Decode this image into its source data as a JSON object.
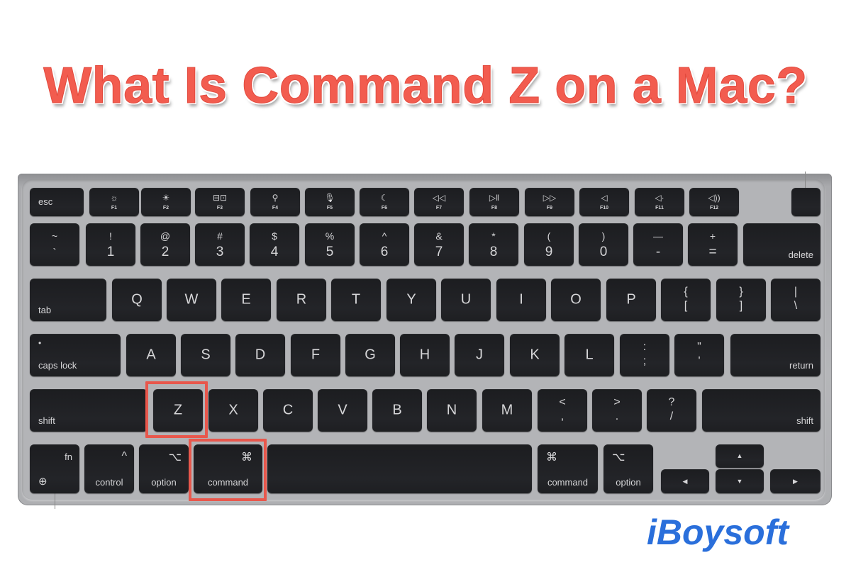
{
  "title": "What Is Command Z on a Mac?",
  "brand": {
    "name": "iBoysoft",
    "color": "#2a6fdb"
  },
  "colors": {
    "title": "#f25c4f",
    "highlight": "#e8574c",
    "key": "#1f2023",
    "frame": "#b3b4b7"
  },
  "highlighted_keys": [
    "Z",
    "command"
  ],
  "keyboard": {
    "function_row": {
      "esc": "esc",
      "fkeys": [
        {
          "icon": "☼",
          "icon_name": "brightness-down-icon",
          "label": "F1"
        },
        {
          "icon": "☀",
          "icon_name": "brightness-up-icon",
          "label": "F2"
        },
        {
          "icon": "⊟⊡",
          "icon_name": "mission-control-icon",
          "label": "F3"
        },
        {
          "icon": "⚲",
          "icon_name": "search-icon",
          "label": "F4"
        },
        {
          "icon": "🎙",
          "icon_name": "microphone-icon",
          "label": "F5"
        },
        {
          "icon": "☾",
          "icon_name": "do-not-disturb-icon",
          "label": "F6"
        },
        {
          "icon": "◁◁",
          "icon_name": "rewind-icon",
          "label": "F7"
        },
        {
          "icon": "▷‖",
          "icon_name": "play-pause-icon",
          "label": "F8"
        },
        {
          "icon": "▷▷",
          "icon_name": "fast-forward-icon",
          "label": "F9"
        },
        {
          "icon": "◁",
          "icon_name": "mute-icon",
          "label": "F10"
        },
        {
          "icon": "◁·",
          "icon_name": "volume-down-icon",
          "label": "F11"
        },
        {
          "icon": "◁))",
          "icon_name": "volume-up-icon",
          "label": "F12"
        }
      ]
    },
    "number_row": [
      {
        "top": "~",
        "bottom": "`"
      },
      {
        "top": "!",
        "bottom": "1"
      },
      {
        "top": "@",
        "bottom": "2"
      },
      {
        "top": "#",
        "bottom": "3"
      },
      {
        "top": "$",
        "bottom": "4"
      },
      {
        "top": "%",
        "bottom": "5"
      },
      {
        "top": "^",
        "bottom": "6"
      },
      {
        "top": "&",
        "bottom": "7"
      },
      {
        "top": "*",
        "bottom": "8"
      },
      {
        "top": "(",
        "bottom": "9"
      },
      {
        "top": ")",
        "bottom": "0"
      },
      {
        "top": "—",
        "bottom": "-"
      },
      {
        "top": "+",
        "bottom": "="
      }
    ],
    "delete": "delete",
    "tab": "tab",
    "qwerty_row": [
      "Q",
      "W",
      "E",
      "R",
      "T",
      "Y",
      "U",
      "I",
      "O",
      "P"
    ],
    "qwerty_symbols": [
      {
        "top": "{",
        "bottom": "["
      },
      {
        "top": "}",
        "bottom": "]"
      },
      {
        "top": "|",
        "bottom": "\\"
      }
    ],
    "caps_lock": "caps lock",
    "caps_indicator": "•",
    "home_row": [
      "A",
      "S",
      "D",
      "F",
      "G",
      "H",
      "J",
      "K",
      "L"
    ],
    "home_symbols": [
      {
        "top": ":",
        "bottom": ";"
      },
      {
        "top": "\"",
        "bottom": "'"
      }
    ],
    "return": "return",
    "shift_left": "shift",
    "bottom_letters": [
      "Z",
      "X",
      "C",
      "V",
      "B",
      "N",
      "M"
    ],
    "bottom_symbols": [
      {
        "top": "<",
        "bottom": ","
      },
      {
        "top": ">",
        "bottom": "."
      },
      {
        "top": "?",
        "bottom": "/"
      }
    ],
    "shift_right": "shift",
    "modifiers": {
      "fn": "fn",
      "globe": "⊕",
      "control_glyph": "^",
      "control": "control",
      "option_glyph": "⌥",
      "option": "option",
      "command_glyph": "⌘",
      "command": "command",
      "command_right": "command",
      "option_right": "option"
    },
    "arrows": {
      "up": "▲",
      "down": "▼",
      "left": "◀",
      "right": "▶"
    }
  }
}
